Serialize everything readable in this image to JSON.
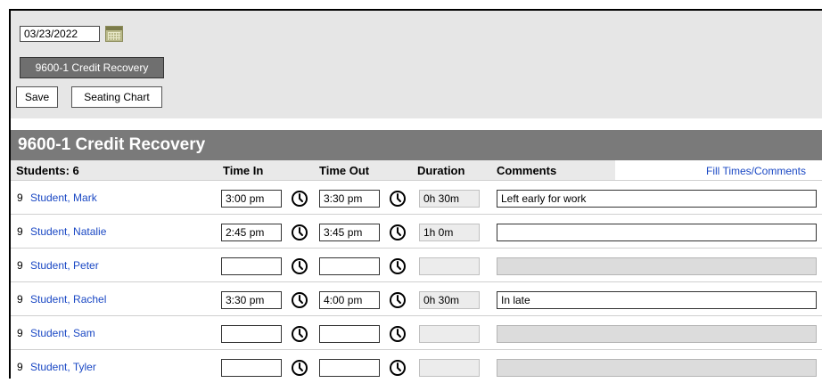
{
  "toolbar": {
    "date_value": "03/23/2022",
    "calendar_icon": "calendar-icon",
    "section_label": "9600-1 Credit Recovery",
    "save_label": "Save",
    "seating_chart_label": "Seating Chart"
  },
  "section_title": "9600-1 Credit Recovery",
  "table": {
    "headers": {
      "students": "Students: 6",
      "time_in": "Time In",
      "time_out": "Time Out",
      "duration": "Duration",
      "comments": "Comments"
    },
    "fill_link": "Fill Times/Comments",
    "clock_icon": "clock-icon",
    "rows": [
      {
        "grade": "9",
        "name": "Student, Mark",
        "time_in": "3:00 pm",
        "time_out": "3:30 pm",
        "duration": "0h 30m",
        "comment": "Left early for work",
        "comment_enabled": true
      },
      {
        "grade": "9",
        "name": "Student, Natalie",
        "time_in": "2:45 pm",
        "time_out": "3:45 pm",
        "duration": "1h 0m",
        "comment": "",
        "comment_enabled": true
      },
      {
        "grade": "9",
        "name": "Student, Peter",
        "time_in": "",
        "time_out": "",
        "duration": "",
        "comment": "",
        "comment_enabled": false
      },
      {
        "grade": "9",
        "name": "Student, Rachel",
        "time_in": "3:30 pm",
        "time_out": "4:00 pm",
        "duration": "0h 30m",
        "comment": "In late",
        "comment_enabled": true
      },
      {
        "grade": "9",
        "name": "Student, Sam",
        "time_in": "",
        "time_out": "",
        "duration": "",
        "comment": "",
        "comment_enabled": false
      },
      {
        "grade": "9",
        "name": "Student, Tyler",
        "time_in": "",
        "time_out": "",
        "duration": "",
        "comment": "",
        "comment_enabled": false
      }
    ]
  }
}
